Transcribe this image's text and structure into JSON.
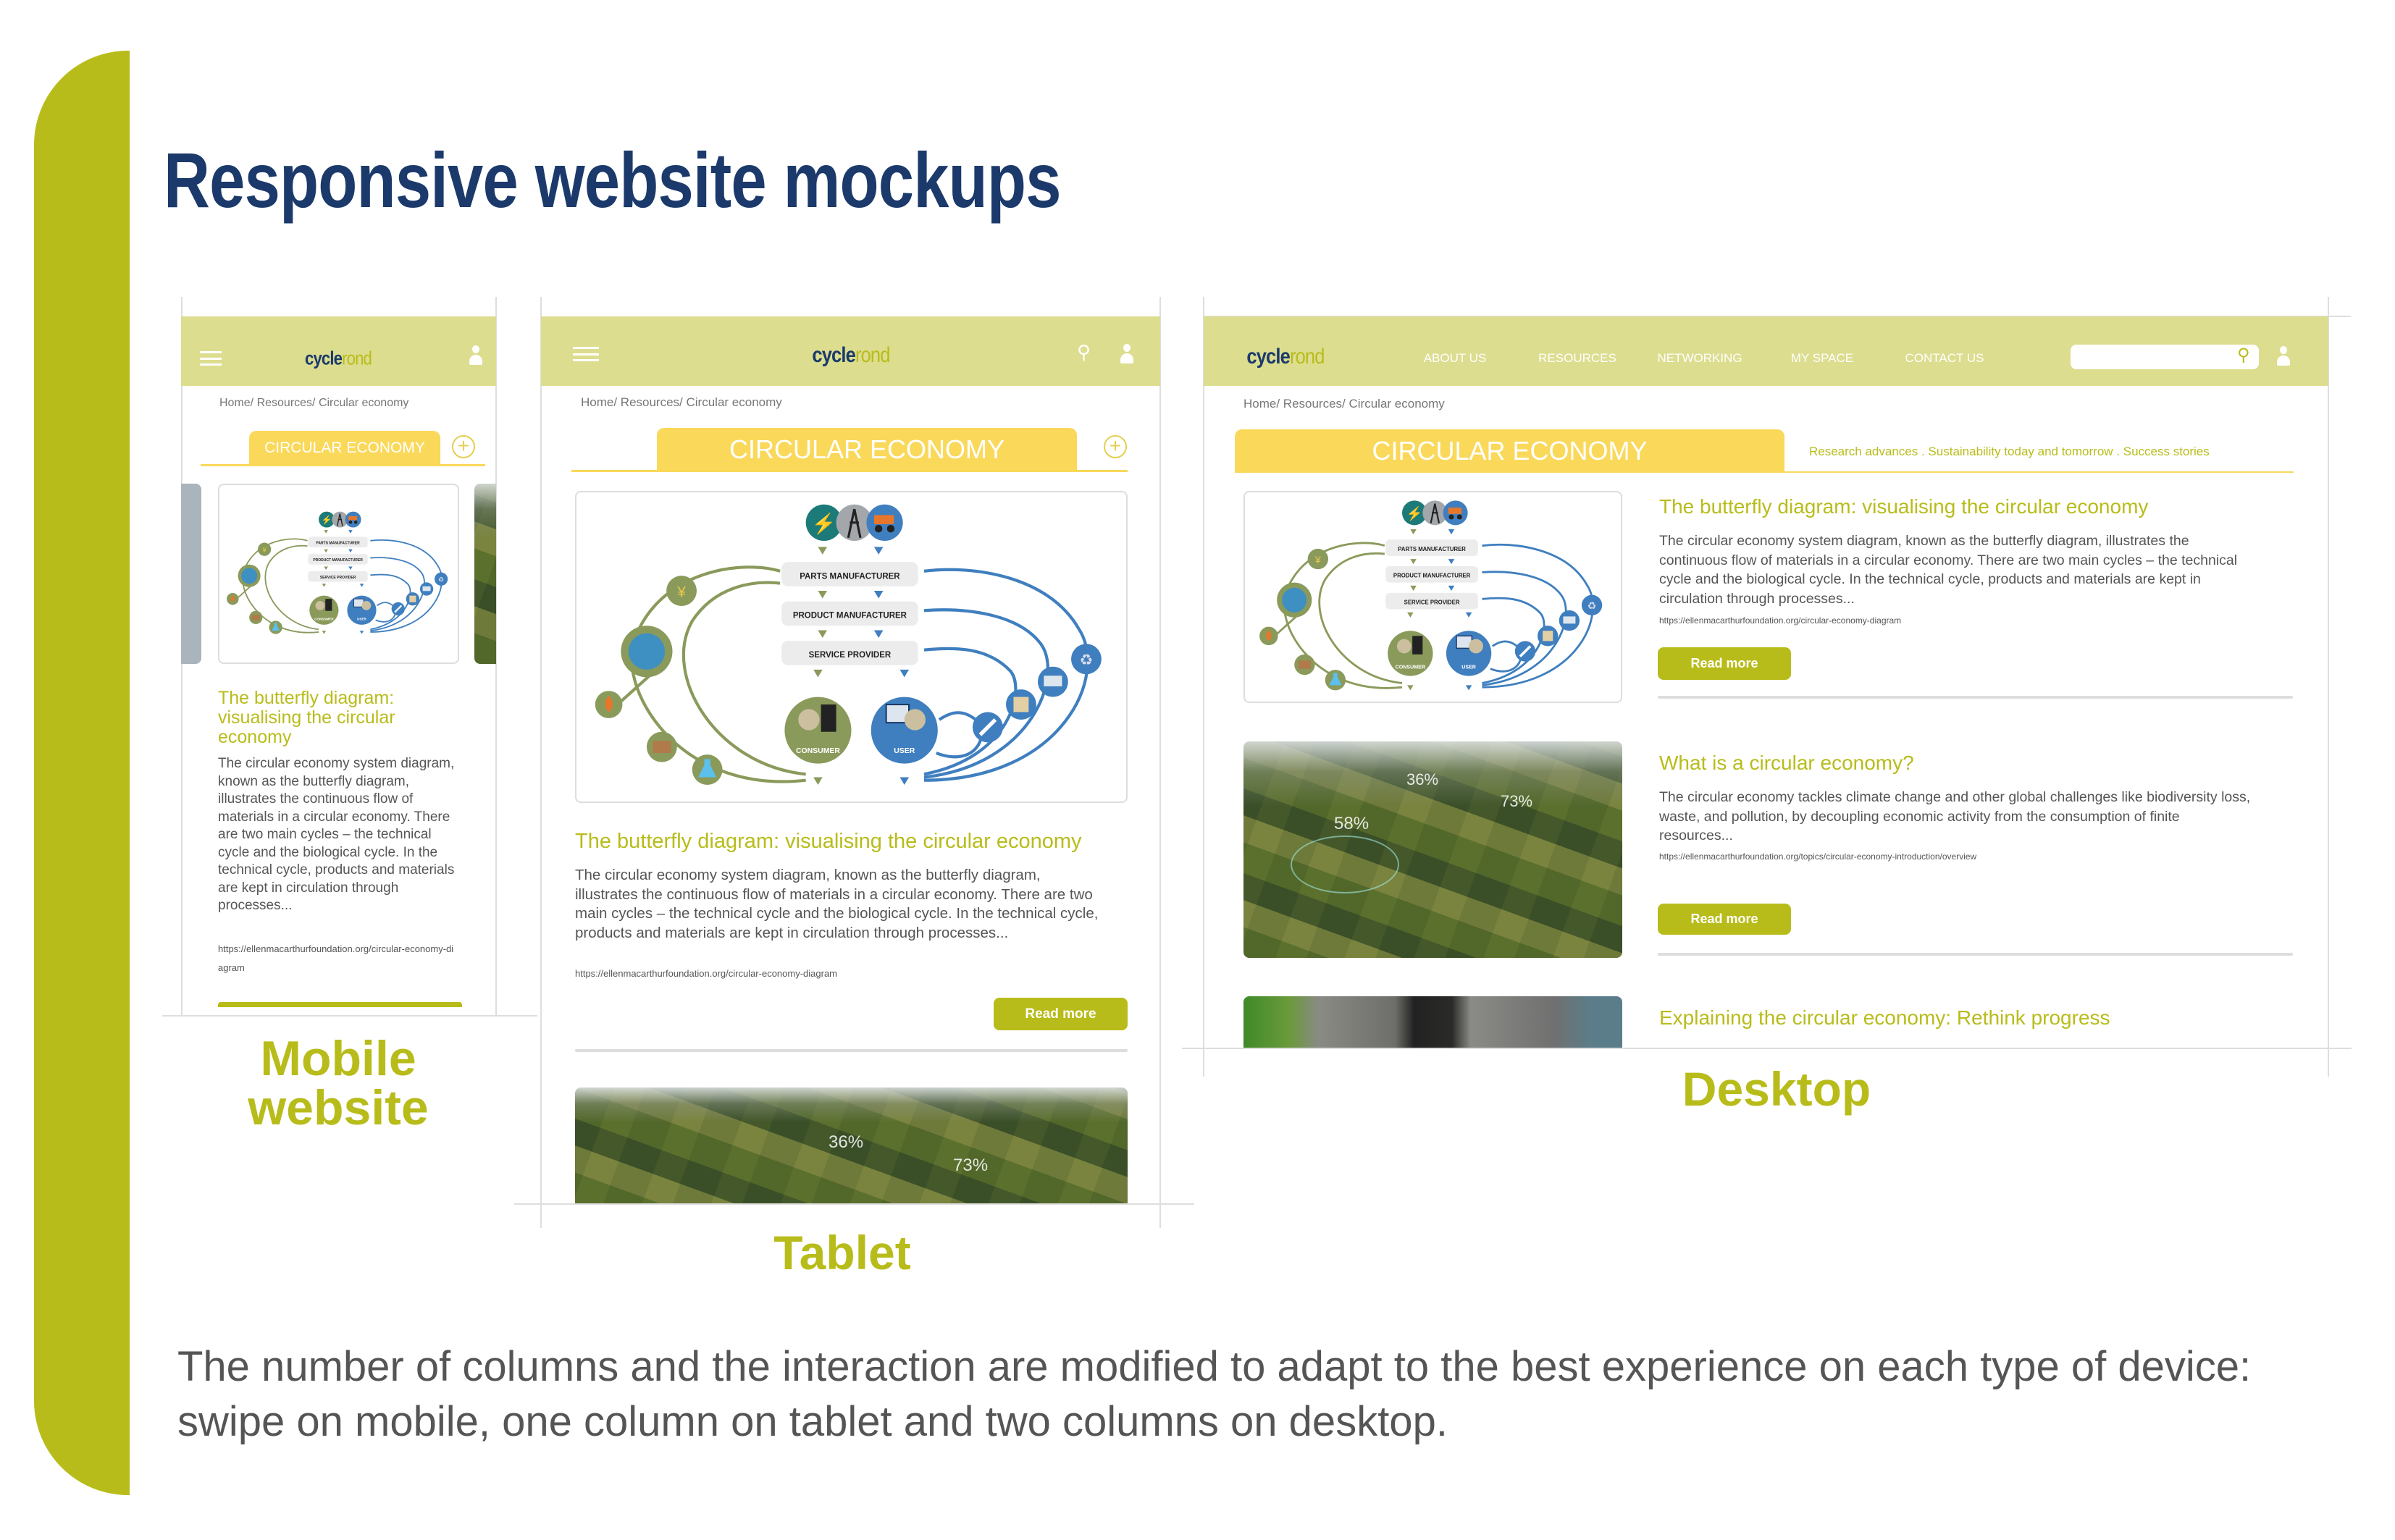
{
  "page": {
    "title": "Responsive website mockups",
    "footer": "The number of columns and the interaction are modified to adapt to the best experience on each type of device: swipe on mobile, one column on tablet and two columns on desktop."
  },
  "brand": {
    "logo_a": "cycle",
    "logo_b": "rond",
    "accent": "#b8bc1a",
    "header_bg": "#dcdd8f",
    "tab_bg": "#fad85a",
    "navy": "#1b3a6b"
  },
  "labels": {
    "mobile_1": "Mobile",
    "mobile_2": "website",
    "tablet": "Tablet",
    "desktop": "Desktop"
  },
  "breadcrumb": "Home/ Resources/ Circular economy",
  "section_tab": "CIRCULAR ECONOMY",
  "nav": [
    "ABOUT US",
    "RESOURCES",
    "NETWORKING",
    "MY SPACE",
    "CONTACT US"
  ],
  "subnav": "Research advances . Sustainability today and tomorrow .  Success stories",
  "read_more": "Read more",
  "diagram": {
    "boxes": [
      "PARTS MANUFACTURER",
      "PRODUCT MANUFACTURER",
      "SERVICE PROVIDER"
    ],
    "consumer": "CONSUMER",
    "user": "USER"
  },
  "aerial": {
    "p1": "36%",
    "p2": "73%",
    "p3": "58%"
  },
  "articles": [
    {
      "title": "The butterfly diagram: visualising the circular economy",
      "body": "The circular economy system diagram, known as the butterfly diagram, illustrates the continuous flow of materials in a circular economy. There are two main cycles – the technical cycle and the biological cycle. In the technical cycle, products and materials are kept in circulation through processes...",
      "url": "https://ellenmacarthurfoundation.org/circular-economy-diagram"
    },
    {
      "title": "What is a circular economy?",
      "body": "The circular economy tackles climate change and other global challenges like biodiversity loss, waste, and pollution, by decoupling economic activity from the consumption of finite resources...",
      "url": "https://ellenmacarthurfoundation.org/topics/circular-economy-introduction/overview"
    },
    {
      "title": "Explaining the circular economy: Rethink progress"
    }
  ]
}
